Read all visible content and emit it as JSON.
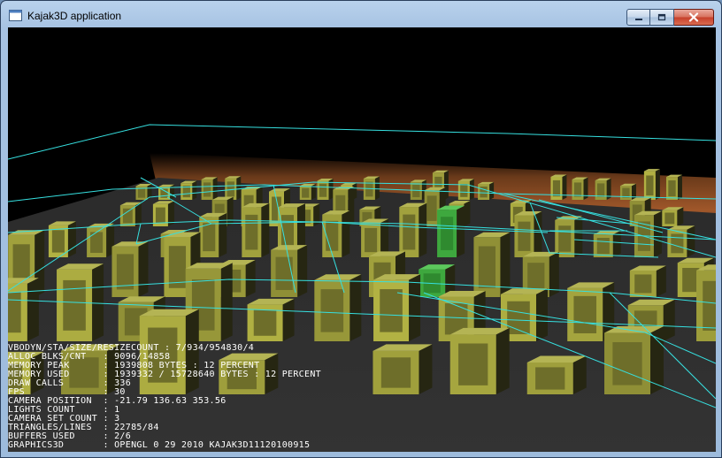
{
  "window": {
    "title": "Kajak3D application",
    "icon": "app-window-icon",
    "controls": [
      "minimize-icon",
      "maximize-icon",
      "close-icon"
    ]
  },
  "colors": {
    "background": "#000000",
    "building_face": "#9a9a3c",
    "building_dark": "#262612",
    "ground": "#2f2f2f",
    "grid_lines": "#36e0e0",
    "horizon_glow": "#7a4420",
    "highlight_building": "#3ea83e",
    "hud_text": "#ffffff"
  },
  "hud": [
    {
      "label": "VBODYN/STA/SIZE/RESIZECOUNT",
      "value": "7/934/954830/4"
    },
    {
      "label": "ALLOC BLKS/CNT  ",
      "value": "9096/14858"
    },
    {
      "label": "MEMORY PEAK     ",
      "value": "1939808 BYTES : 12 PERCENT"
    },
    {
      "label": "MEMORY USED     ",
      "value": "1939332 / 15728640 BYTES : 12 PERCENT"
    },
    {
      "label": "DRAW CALLS      ",
      "value": "336"
    },
    {
      "label": "FPS             ",
      "value": "30"
    },
    {
      "label": "CAMERA POSITION ",
      "value": "-21.79 136.63 353.56"
    },
    {
      "label": "LIGHTS COUNT    ",
      "value": "1"
    },
    {
      "label": "CAMERA SET COUNT",
      "value": "3"
    },
    {
      "label": "TRIANGLES/LINES ",
      "value": "22785/84"
    },
    {
      "label": "BUFFERS USED    ",
      "value": "2/6"
    },
    {
      "label": "GRAPHICS3D      ",
      "value": "OPENGL 0 29 2010 KAJAK3D11120100915"
    }
  ]
}
